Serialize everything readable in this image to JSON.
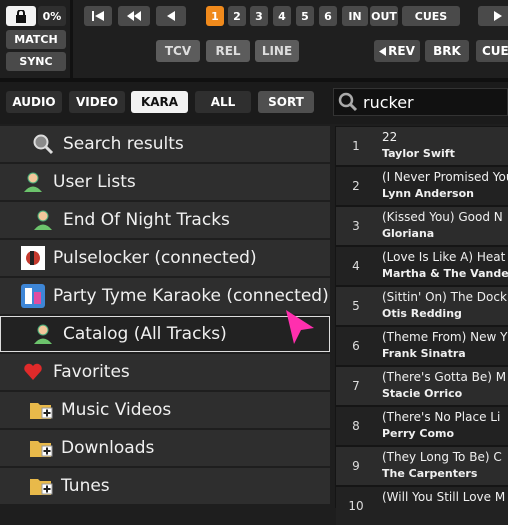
{
  "deck": {
    "pct": "0%",
    "match": "MATCH",
    "sync": "SYNC",
    "hotcues": [
      "1",
      "2",
      "3",
      "4",
      "5",
      "6"
    ],
    "in": "IN",
    "out": "OUT",
    "cues": "CUES",
    "tcv": "TCV",
    "rel": "REL",
    "line": "LINE",
    "rev": "REV",
    "brk": "BRK",
    "cue": "CUE"
  },
  "filters": {
    "audio": "AUDIO",
    "video": "VIDEO",
    "kara": "KARA",
    "all": "ALL",
    "sort": "SORT"
  },
  "search": {
    "value": "rucker"
  },
  "tree": [
    {
      "label": "Search results",
      "icon": "search-icon"
    },
    {
      "label": "User Lists",
      "icon": "user-icon"
    },
    {
      "label": "End Of Night Tracks",
      "icon": "user-icon"
    },
    {
      "label": "Pulselocker (connected)",
      "icon": "pulselocker-icon"
    },
    {
      "label": "Party Tyme Karaoke (connected)",
      "icon": "partytyme-icon"
    },
    {
      "label": "Catalog (All Tracks)",
      "icon": "user-icon"
    },
    {
      "label": "Favorites",
      "icon": "heart-icon"
    },
    {
      "label": "Music Videos",
      "icon": "folder-plus-icon"
    },
    {
      "label": "Downloads",
      "icon": "folder-plus-icon"
    },
    {
      "label": "Tunes",
      "icon": "folder-plus-icon"
    }
  ],
  "tracks": [
    {
      "num": "1",
      "title": "22",
      "artist": "Taylor Swift"
    },
    {
      "num": "2",
      "title": "(I Never Promised You",
      "artist": "Lynn Anderson"
    },
    {
      "num": "3",
      "title": "(Kissed You) Good N",
      "artist": "Gloriana"
    },
    {
      "num": "4",
      "title": "(Love Is Like A) Heat",
      "artist": "Martha & The Vandellas"
    },
    {
      "num": "5",
      "title": "(Sittin' On) The Dock",
      "artist": "Otis Redding"
    },
    {
      "num": "6",
      "title": "(Theme From) New Y",
      "artist": "Frank Sinatra"
    },
    {
      "num": "7",
      "title": "(There's Gotta Be) M",
      "artist": "Stacie Orrico"
    },
    {
      "num": "8",
      "title": "(There's No Place Li",
      "artist": "Perry Como"
    },
    {
      "num": "9",
      "title": "(They Long To Be) C",
      "artist": "The Carpenters"
    },
    {
      "num": "10",
      "title": "(Will You Still Love M",
      "artist": ""
    }
  ]
}
